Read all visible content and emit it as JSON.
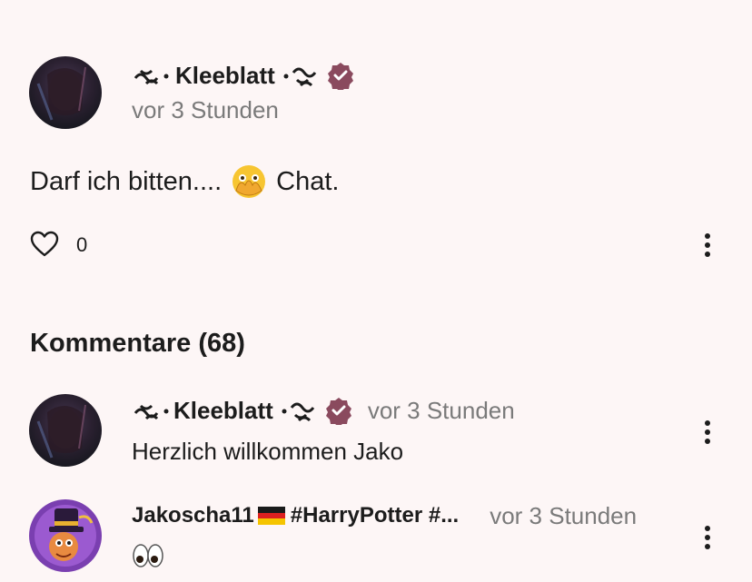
{
  "post": {
    "author": "Kleeblatt",
    "time": "vor 3 Stunden",
    "body_before": "Darf ich bitten....",
    "body_after": "Chat.",
    "emoji": "face-with-open-eyes-and-hand-over-mouth",
    "like_count": "0"
  },
  "comments_section": {
    "title": "Kommentare (68)",
    "items": [
      {
        "author": "Kleeblatt",
        "time": "vor 3 Stunden",
        "text": "Herzlich willkommen Jako"
      },
      {
        "author": "Jakoscha11",
        "author_suffix": "#HarryPotter #...",
        "time": "vor 3 Stunden",
        "text_emoji": "eyes"
      }
    ]
  },
  "colors": {
    "background": "#fdf6f6",
    "verified_badge": "#8a4a5e",
    "muted_text": "#7a7a7a"
  }
}
